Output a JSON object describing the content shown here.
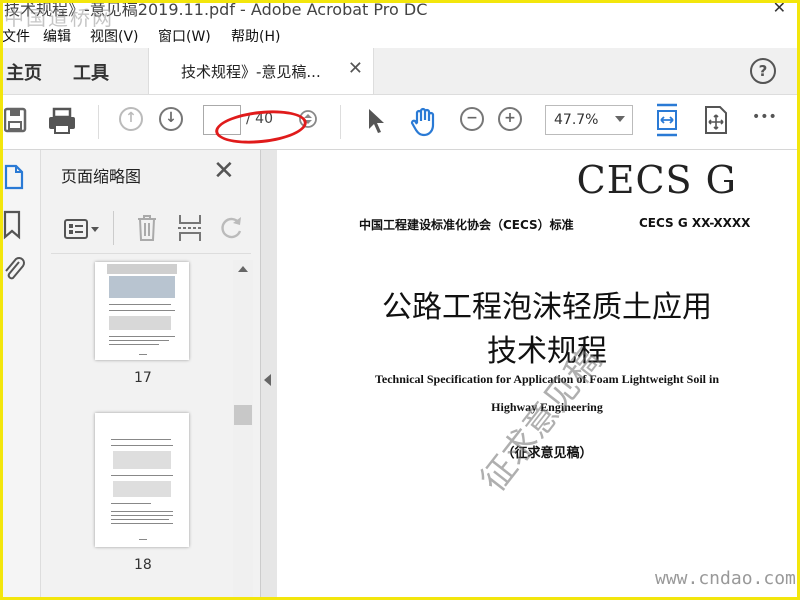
{
  "window": {
    "title": "技术规程》-意见稿2019.11.pdf - Adobe Acrobat Pro DC",
    "close_label": "✕"
  },
  "watermarks": {
    "top_left": "中国道桥网",
    "bottom_right": "www.cndao.com"
  },
  "menu": {
    "items": [
      "文件",
      "编辑",
      "视图(V)",
      "窗口(W)",
      "帮助(H)"
    ]
  },
  "tabs": {
    "home": "主页",
    "tools": "工具",
    "document": "技术规程》-意见稿...",
    "close": "✕",
    "help": "?"
  },
  "toolbar": {
    "current_page": "",
    "page_total": "/ 40",
    "zoom": "47.7%",
    "more": "•••",
    "highlight_color": "#e01b1b",
    "accent_color": "#2a7ad5"
  },
  "panel": {
    "title": "页面缩略图",
    "close": "✕",
    "thumbnails": [
      {
        "label": "17"
      },
      {
        "label": "18"
      }
    ]
  },
  "document": {
    "series": "CECS G",
    "org": "中国工程建设标准化协会（CECS）标准",
    "code": "CECS G XX-XXXX",
    "title_cn_line1": "公路工程泡沫轻质土应用",
    "title_cn_line2": "技术规程",
    "title_en_line1": "Technical Specification for Application of Foam Lightweight Soil in",
    "title_en_line2": "Highway Engineering",
    "draft": "（征求意见稿）",
    "stamp": "征求意见稿"
  }
}
